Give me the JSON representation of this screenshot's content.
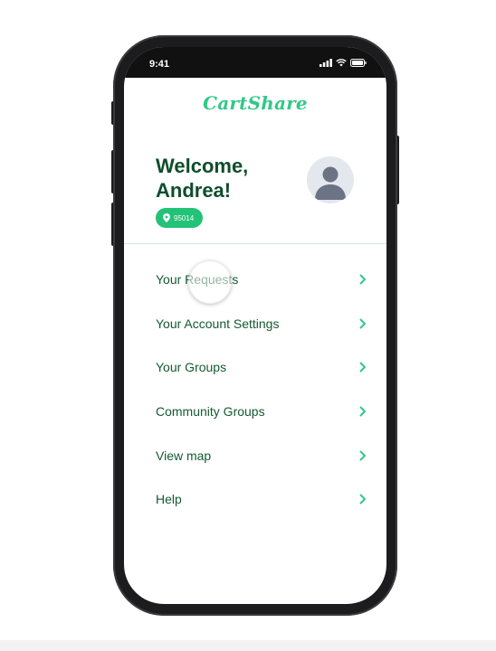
{
  "status_bar": {
    "time": "9:41"
  },
  "app": {
    "logo_text": "CartShare",
    "brand_color": "#2fc987",
    "text_color": "#145a32"
  },
  "header": {
    "greeting_line1": "Welcome,",
    "greeting_line2": "Andrea!",
    "zip_code": "95014",
    "location_icon": "map-pin-icon",
    "avatar_icon": "user-avatar-icon"
  },
  "menu": {
    "items": [
      {
        "label": "Your Requests",
        "icon": "chevron-right-icon"
      },
      {
        "label": "Your Account Settings",
        "icon": "chevron-right-icon"
      },
      {
        "label": "Your Groups",
        "icon": "chevron-right-icon"
      },
      {
        "label": "Community Groups",
        "icon": "chevron-right-icon"
      },
      {
        "label": "View map",
        "icon": "chevron-right-icon"
      },
      {
        "label": "Help",
        "icon": "chevron-right-icon"
      }
    ]
  }
}
